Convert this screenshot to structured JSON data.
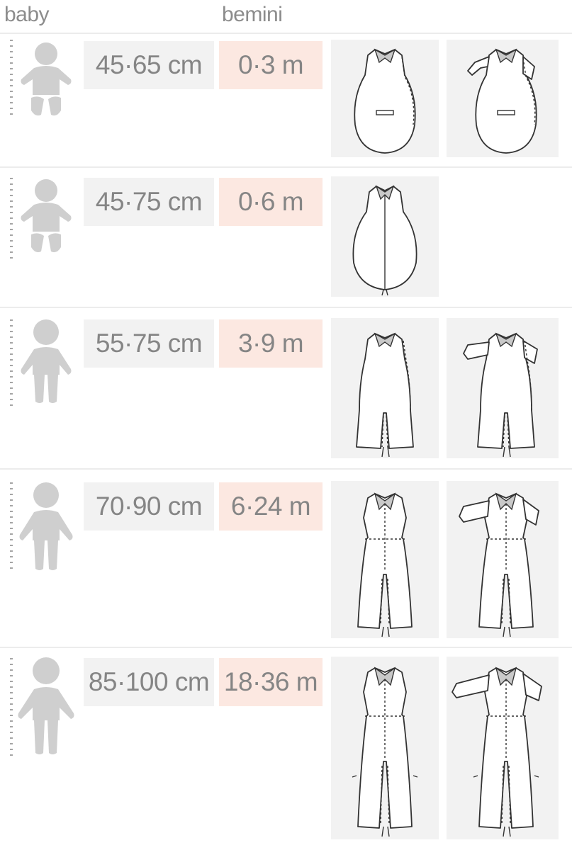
{
  "header": {
    "col_baby": "baby",
    "col_brand": "bemini"
  },
  "rows": [
    {
      "size": "45·65 cm",
      "age": "0·3 m",
      "figure": "infant",
      "garments": [
        "sleeping-bag-icon",
        "sleeping-bag-with-sleeves-icon"
      ]
    },
    {
      "size": "45·75 cm",
      "age": "0·6 m",
      "figure": "infant",
      "garments": [
        "sleeping-bag-zip-icon"
      ]
    },
    {
      "size": "55·75 cm",
      "age": "3·9 m",
      "figure": "toddler",
      "garments": [
        "sleeping-bag-legs-icon",
        "sleeping-bag-legs-with-sleeves-icon"
      ]
    },
    {
      "size": "70·90 cm",
      "age": "6·24 m",
      "figure": "child",
      "garments": [
        "sleeping-suit-icon",
        "sleeping-suit-with-sleeves-icon"
      ]
    },
    {
      "size": "85·100 cm",
      "age": "18·36 m",
      "figure": "child",
      "garments": [
        "sleeping-suit-long-icon",
        "sleeping-suit-long-with-sleeves-icon"
      ]
    }
  ],
  "colors": {
    "size_box": "#f2f2f2",
    "age_box": "#fce8e1",
    "text": "#858585",
    "figure": "#cfcfcf"
  }
}
